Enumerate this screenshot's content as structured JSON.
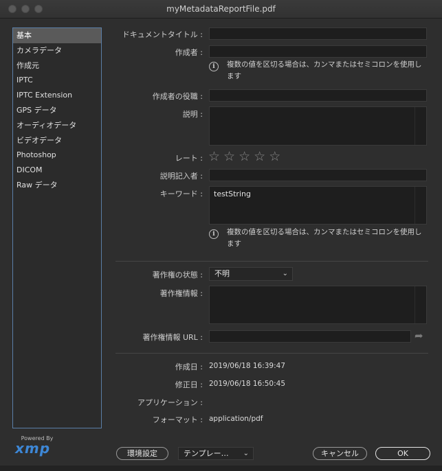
{
  "window": {
    "title": "myMetadataReportFile.pdf"
  },
  "sidebar": {
    "items": [
      {
        "label": "基本",
        "selected": true
      },
      {
        "label": "カメラデータ"
      },
      {
        "label": "作成元"
      },
      {
        "label": "IPTC"
      },
      {
        "label": "IPTC Extension"
      },
      {
        "label": "GPS データ"
      },
      {
        "label": "オーディオデータ"
      },
      {
        "label": "ビデオデータ"
      },
      {
        "label": "Photoshop"
      },
      {
        "label": "DICOM"
      },
      {
        "label": "Raw データ"
      }
    ]
  },
  "logo": {
    "powered_by": "Powered By",
    "name": "xmp"
  },
  "form": {
    "document_title": {
      "label": "ドキュメントタイトル :",
      "value": ""
    },
    "author": {
      "label": "作成者 :",
      "value": ""
    },
    "author_note": "複数の値を区切る場合は、カンマまたはセミコロンを使用します",
    "author_title": {
      "label": "作成者の役職 :",
      "value": ""
    },
    "description": {
      "label": "説明 :",
      "value": ""
    },
    "rating": {
      "label": "レート :",
      "value": 0,
      "max": 5
    },
    "description_writer": {
      "label": "説明記入者 :",
      "value": ""
    },
    "keywords": {
      "label": "キーワード :",
      "value": "testString"
    },
    "keywords_note": "複数の値を区切る場合は、カンマまたはセミコロンを使用します",
    "copyright_status": {
      "label": "著作権の状態 :",
      "value": "不明"
    },
    "copyright_notice": {
      "label": "著作権情報 :",
      "value": ""
    },
    "copyright_url": {
      "label": "著作権情報 URL :",
      "value": ""
    },
    "created": {
      "label": "作成日 :",
      "value": "2019/06/18 16:39:47"
    },
    "modified": {
      "label": "修正日 :",
      "value": "2019/06/18 16:50:45"
    },
    "application": {
      "label": "アプリケーション :",
      "value": ""
    },
    "format": {
      "label": "フォーマット :",
      "value": "application/pdf"
    }
  },
  "footer": {
    "preferences": "環境設定",
    "template": "テンプレー…",
    "cancel": "キャンセル",
    "ok": "OK"
  },
  "icons": {
    "info": "i",
    "star": "☆",
    "chevron": "⌄",
    "share": "➦"
  }
}
